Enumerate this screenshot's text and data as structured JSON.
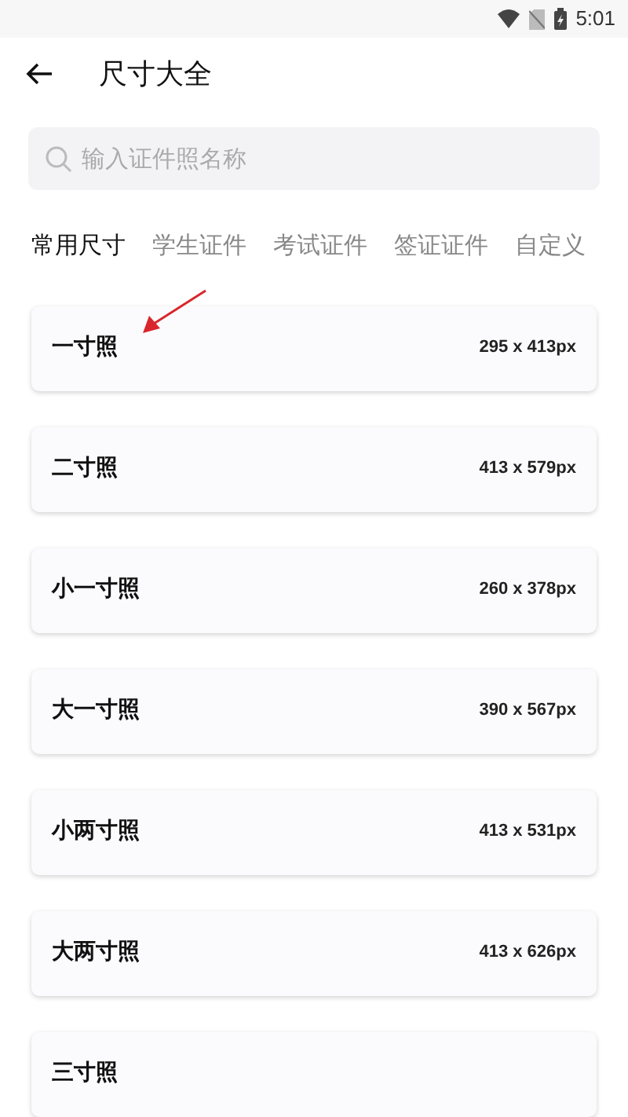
{
  "status_bar": {
    "time": "5:01"
  },
  "header": {
    "title": "尺寸大全"
  },
  "search": {
    "placeholder": "输入证件照名称"
  },
  "tabs": [
    {
      "label": "常用尺寸",
      "selected": true
    },
    {
      "label": "学生证件",
      "selected": false
    },
    {
      "label": "考试证件",
      "selected": false
    },
    {
      "label": "签证证件",
      "selected": false
    },
    {
      "label": "自定义",
      "selected": false
    }
  ],
  "sizes": [
    {
      "name": "一寸照",
      "size": "295 x 413px"
    },
    {
      "name": "二寸照",
      "size": "413 x 579px"
    },
    {
      "name": "小一寸照",
      "size": "260 x 378px"
    },
    {
      "name": "大一寸照",
      "size": "390 x 567px"
    },
    {
      "name": "小两寸照",
      "size": "413 x 531px"
    },
    {
      "name": "大两寸照",
      "size": "413 x 626px"
    },
    {
      "name": "三寸照"
    }
  ]
}
